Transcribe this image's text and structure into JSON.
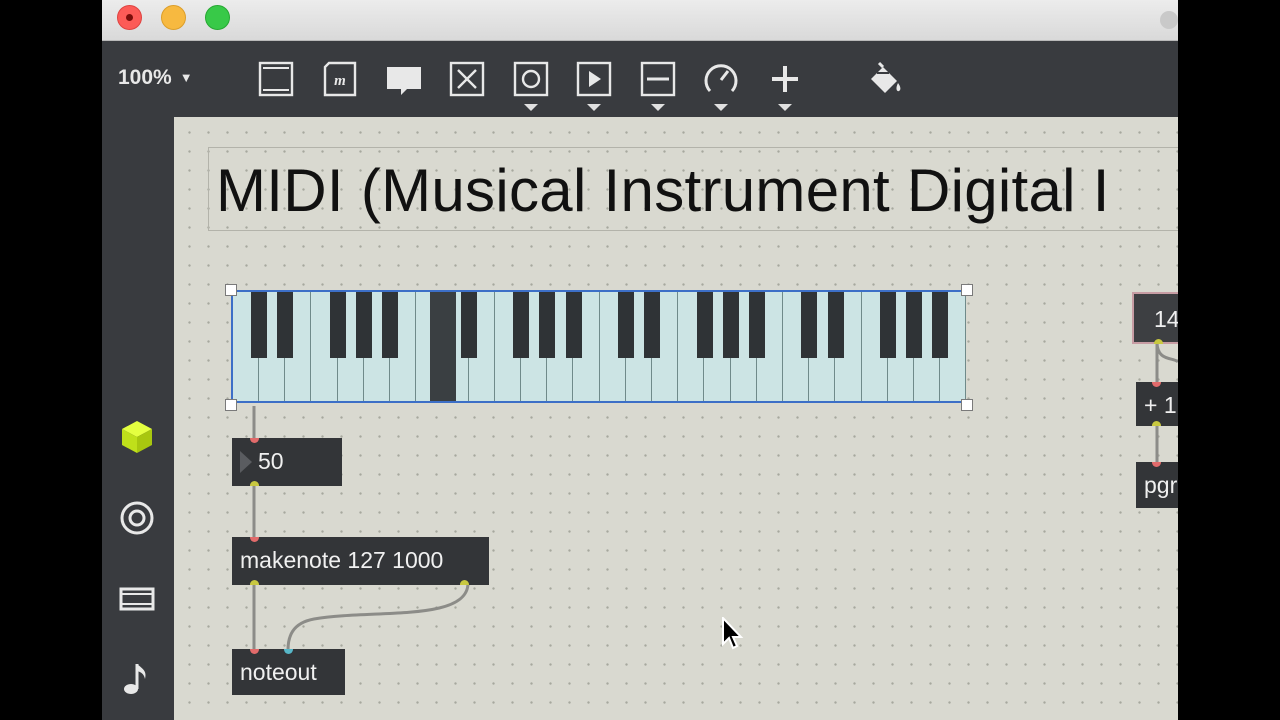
{
  "toolbar": {
    "zoom": "100%",
    "tools": [
      {
        "icon": "new-object-icon",
        "has_menu": false
      },
      {
        "icon": "message-icon",
        "has_menu": false
      },
      {
        "icon": "comment-icon",
        "has_menu": false
      },
      {
        "icon": "button-object-icon",
        "has_menu": false
      },
      {
        "icon": "toggle-object-icon",
        "has_menu": true
      },
      {
        "icon": "play-object-icon",
        "has_menu": true
      },
      {
        "icon": "slider-object-icon",
        "has_menu": true
      },
      {
        "icon": "dial-object-icon",
        "has_menu": true
      },
      {
        "icon": "add-object-icon",
        "has_menu": true
      },
      {
        "icon": "paint-bucket-icon",
        "has_menu": false
      }
    ]
  },
  "sidebar": {
    "items": [
      {
        "icon": "package-cube-icon",
        "color": "#d4f020"
      },
      {
        "icon": "target-icon"
      },
      {
        "icon": "film-icon"
      },
      {
        "icon": "music-note-icon"
      }
    ]
  },
  "canvas": {
    "title": "MIDI (Musical Instrument Digital I",
    "keyboard": {
      "pressed_key": "C#"
    },
    "number_box": "50",
    "makenote": "makenote 127 1000",
    "noteout": "noteout",
    "right_number": "14",
    "right_plus": "+ 1",
    "right_pgm": "pgr"
  },
  "colors": {
    "canvas_bg": "#d9d9d0",
    "object_bg": "#333538",
    "selection": "#3c6fc7",
    "inlet": "#e26b6b",
    "outlet": "#c8c840"
  }
}
